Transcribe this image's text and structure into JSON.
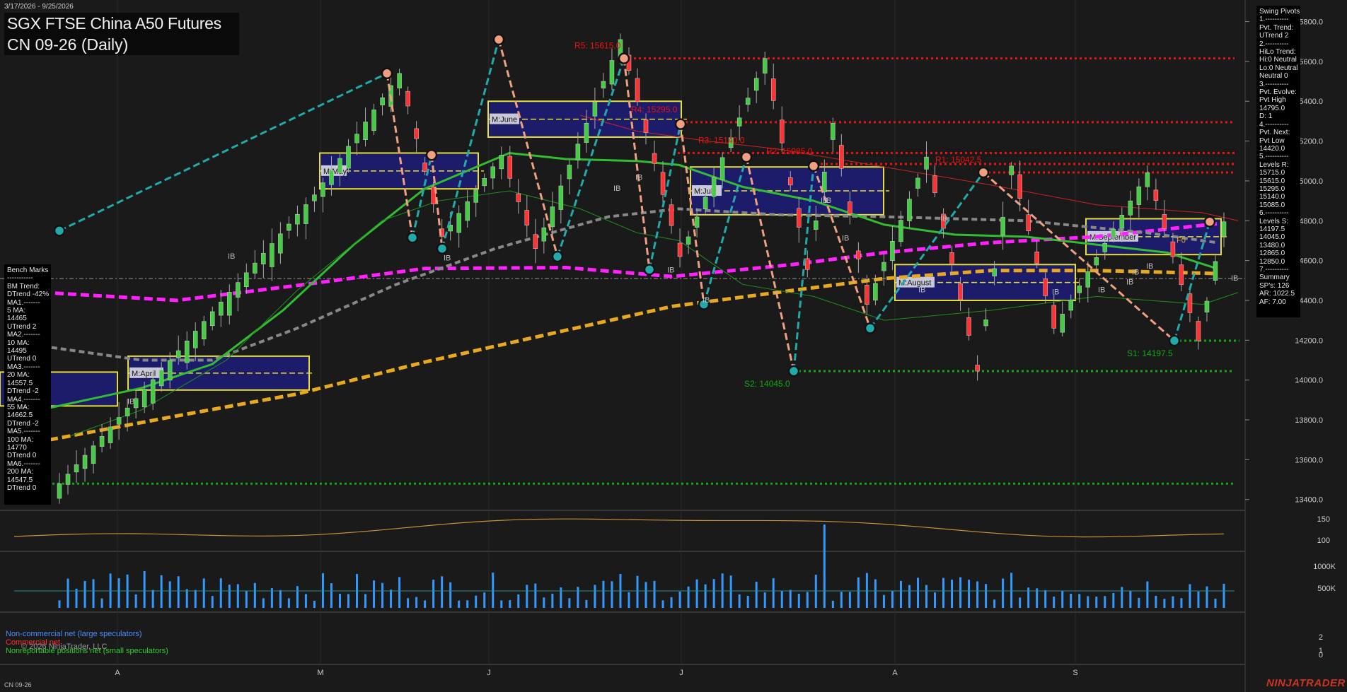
{
  "header": {
    "date_range": "3/17/2026 - 9/25/2026",
    "title_line1": "SGX FTSE China A50 Futures",
    "title_line2": "CN 09-26 (Daily)"
  },
  "swing_pivots_panel": {
    "lines": [
      "Swing Pivots",
      "1.----------",
      "Pvt. Trend:",
      "UTrend 2",
      "2.----------",
      "HiLo Trend:",
      "Hi:0 Neutral",
      "Lo:0 Neutral",
      "Neutral 0",
      "3.----------",
      "Pvt. Evolve:",
      "Pvt High",
      "14795.0",
      "D: 1",
      "4.----------",
      "Pvt. Next:",
      "Pvt Low",
      "14420.0",
      "5.----------",
      "Levels R:",
      "15715.0",
      "15615.0",
      "15295.0",
      "15140.0",
      "15085.0",
      "6.----------",
      "Levels S:",
      "14197.5",
      "14045.0",
      "13480.0",
      "12865.0",
      "12850.0",
      "7.----------",
      "Summary",
      "SP's: 126",
      "AR: 1022.5",
      "AF: 7.00"
    ]
  },
  "benchmarks_panel": {
    "lines": [
      "Bench Marks",
      "-----------",
      "BM Trend:",
      "DTrend -42%",
      "MA1.-------",
      "5 MA:",
      "14465",
      "UTrend 2",
      "MA2.-------",
      "10 MA:",
      "14495",
      "UTrend 0",
      "MA3.-------",
      "20 MA:",
      "14557.5",
      "DTrend -2",
      "MA4.-------",
      "55 MA:",
      "14662.5",
      "DTrend -2",
      "MA5.-------",
      "100 MA:",
      "14770",
      "DTrend 0",
      "MA6.-------",
      "200 MA:",
      "14547.5",
      "DTrend 0"
    ]
  },
  "footer": {
    "symbol": "CN 09-26",
    "brand": "NINJATRADER",
    "copyright": "© 2026 NinjaTrader, LLC",
    "cot_large": "Non-commercial net (large speculators)",
    "cot_commercial": "Commercial net",
    "cot_small": "Nonreportable positions net (small speculators)"
  },
  "colors": {
    "background": "#1a1a1a",
    "up_candle": "#44cc44",
    "down_candle": "#ff3333",
    "resistance": "#ee1111",
    "support": "#11aa11",
    "swing_up": "#22aaaa",
    "swing_down": "#f0a080",
    "ma_magenta": "#ff22ff",
    "ma_orange": "#e8a820",
    "ma_grey": "#888888",
    "ma_green": "#33bb33",
    "volume": "#3399ff"
  },
  "chart_data": {
    "type": "candlestick",
    "price_axis": {
      "ticks": [
        "15800.0",
        "15600.0",
        "15400.0",
        "15200.0",
        "15000.0",
        "14800.0",
        "14600.0",
        "14400.0",
        "14200.0",
        "14000.0",
        "13800.0",
        "13600.0",
        "13400.0"
      ],
      "range": [
        13360,
        15880
      ]
    },
    "x_axis_labels": [
      "A",
      "M",
      "J",
      "J",
      "A",
      "S"
    ],
    "levels": [
      {
        "label": "R5: 15615.0",
        "value": 15615,
        "kind": "resistance"
      },
      {
        "label": "R4: 15295.0",
        "value": 15295,
        "kind": "resistance"
      },
      {
        "label": "R3: 15140.0",
        "value": 15140,
        "kind": "resistance"
      },
      {
        "label": "R2: 15085.0",
        "value": 15085,
        "kind": "resistance"
      },
      {
        "label": "R1: 15042.5",
        "value": 15042.5,
        "kind": "resistance"
      },
      {
        "label": "S1: 14197.5",
        "value": 14197.5,
        "kind": "support"
      },
      {
        "label": "S2: 14045.0",
        "value": 14045,
        "kind": "support"
      },
      {
        "label": "",
        "value": 13480,
        "kind": "support"
      }
    ],
    "monthly_boxes": [
      {
        "label": "M:April",
        "high": 14120,
        "low": 13950
      },
      {
        "label": "M:May",
        "high": 15140,
        "low": 14960
      },
      {
        "label": "M:June",
        "high": 15400,
        "low": 15220
      },
      {
        "label": "M:July",
        "high": 15070,
        "low": 14830
      },
      {
        "label": "M:August",
        "high": 14580,
        "low": 14400
      },
      {
        "label": "M:September",
        "high": 14810,
        "low": 14630
      }
    ],
    "swing_pivots": [
      14750,
      15540,
      14715,
      15130,
      14660,
      15710,
      14620,
      15615,
      14555,
      15285,
      14380,
      15120,
      14045,
      15075,
      14260,
      15042.5,
      14197.5,
      14795
    ],
    "ib_labels": [
      "IB",
      "IB",
      "IB",
      "IB",
      "IB",
      "IB",
      "IB",
      "IB",
      "IB",
      "IB",
      "IB",
      "IB",
      "IB",
      "IB",
      "IB",
      "IB",
      "IB",
      "IB"
    ],
    "pf_label": "F0",
    "oscillator_axis": [
      "150",
      "100"
    ],
    "volume_axis": [
      "1000K",
      "500K"
    ],
    "cot_axis": [
      "2",
      "1",
      "0"
    ]
  }
}
